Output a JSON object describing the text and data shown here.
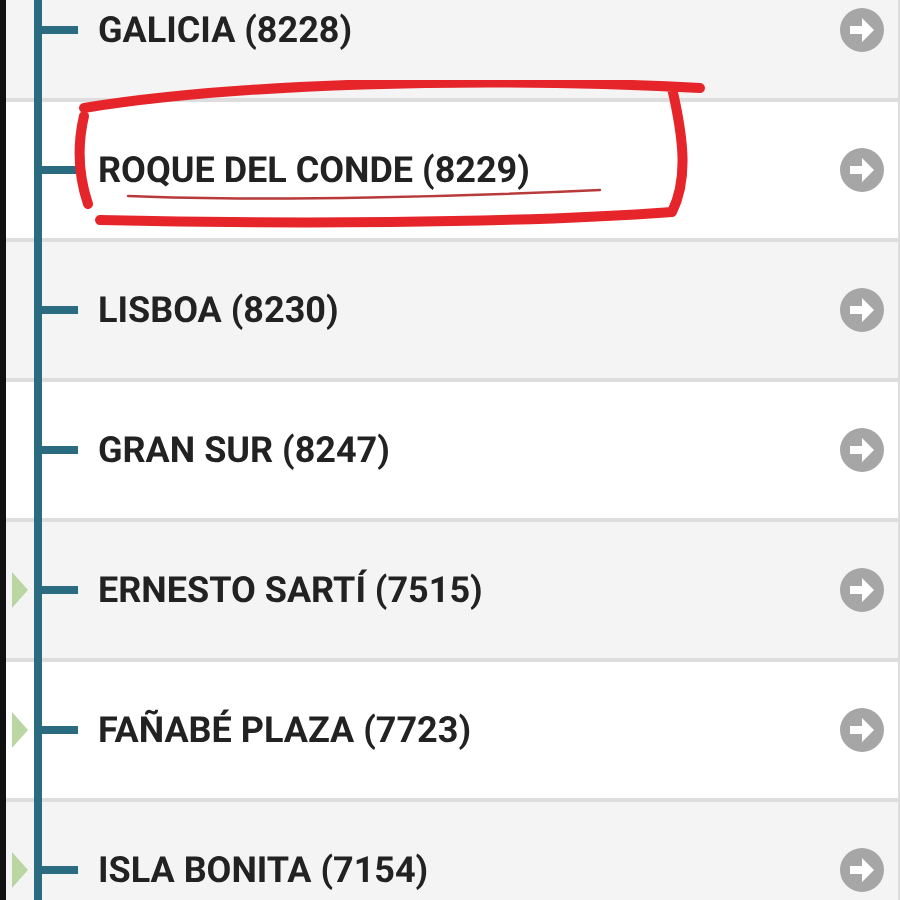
{
  "stops": [
    {
      "name": "GALICIA (8228)",
      "transfer": false,
      "circled": false
    },
    {
      "name": "ROQUE DEL CONDE (8229)",
      "transfer": false,
      "circled": true
    },
    {
      "name": "LISBOA (8230)",
      "transfer": false,
      "circled": false
    },
    {
      "name": "GRAN SUR (8247)",
      "transfer": false,
      "circled": false
    },
    {
      "name": "ERNESTO SARTÍ (7515)",
      "transfer": true,
      "circled": false
    },
    {
      "name": "FAÑABÉ PLAZA (7723)",
      "transfer": true,
      "circled": false
    },
    {
      "name": "ISLA BONITA (7154)",
      "transfer": true,
      "circled": false
    }
  ]
}
